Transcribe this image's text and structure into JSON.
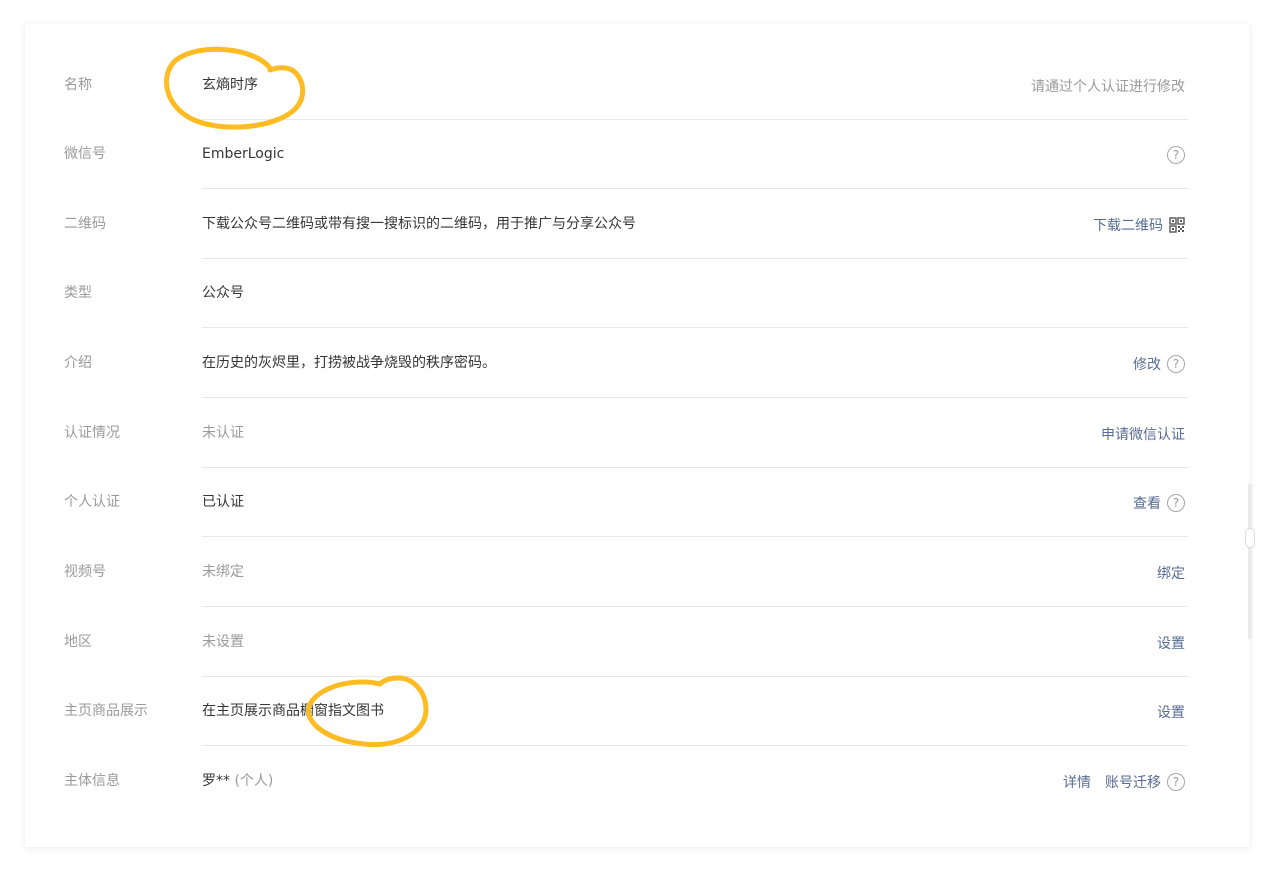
{
  "rows": [
    {
      "label": "名称",
      "value": "玄熵时序",
      "action": "请通过个人认证进行修改"
    },
    {
      "label": "微信号",
      "value": "EmberLogic",
      "help": "?"
    },
    {
      "label": "二维码",
      "value": "下载公众号二维码或带有搜一搜标识的二维码，用于推广与分享公众号",
      "action": "下载二维码"
    },
    {
      "label": "类型",
      "value": "公众号"
    },
    {
      "label": "介绍",
      "value": "在历史的灰烬里，打捞被战争烧毁的秩序密码。",
      "action": "修改",
      "help": "?"
    },
    {
      "label": "认证情况",
      "value": "未认证",
      "action": "申请微信认证"
    },
    {
      "label": "个人认证",
      "value": "已认证",
      "action": "查看",
      "help": "?"
    },
    {
      "label": "视频号",
      "value": "未绑定",
      "action": "绑定"
    },
    {
      "label": "地区",
      "value": "未设置",
      "action": "设置"
    },
    {
      "label": "主页商品展示",
      "value": "在主页展示商品橱窗指文图书",
      "action": "设置"
    },
    {
      "label": "主体信息",
      "value": "罗**",
      "value_sub": "(个人)",
      "action": "详情",
      "action2": "账号迁移",
      "help": "?"
    }
  ],
  "icons": {
    "qr": "qrcode-icon",
    "help": "question-circle-icon"
  },
  "colors": {
    "link": "#576b95",
    "label": "#9a9a9a",
    "text": "#353535",
    "divider": "#e7e7eb",
    "annotation": "#ffbb22"
  }
}
